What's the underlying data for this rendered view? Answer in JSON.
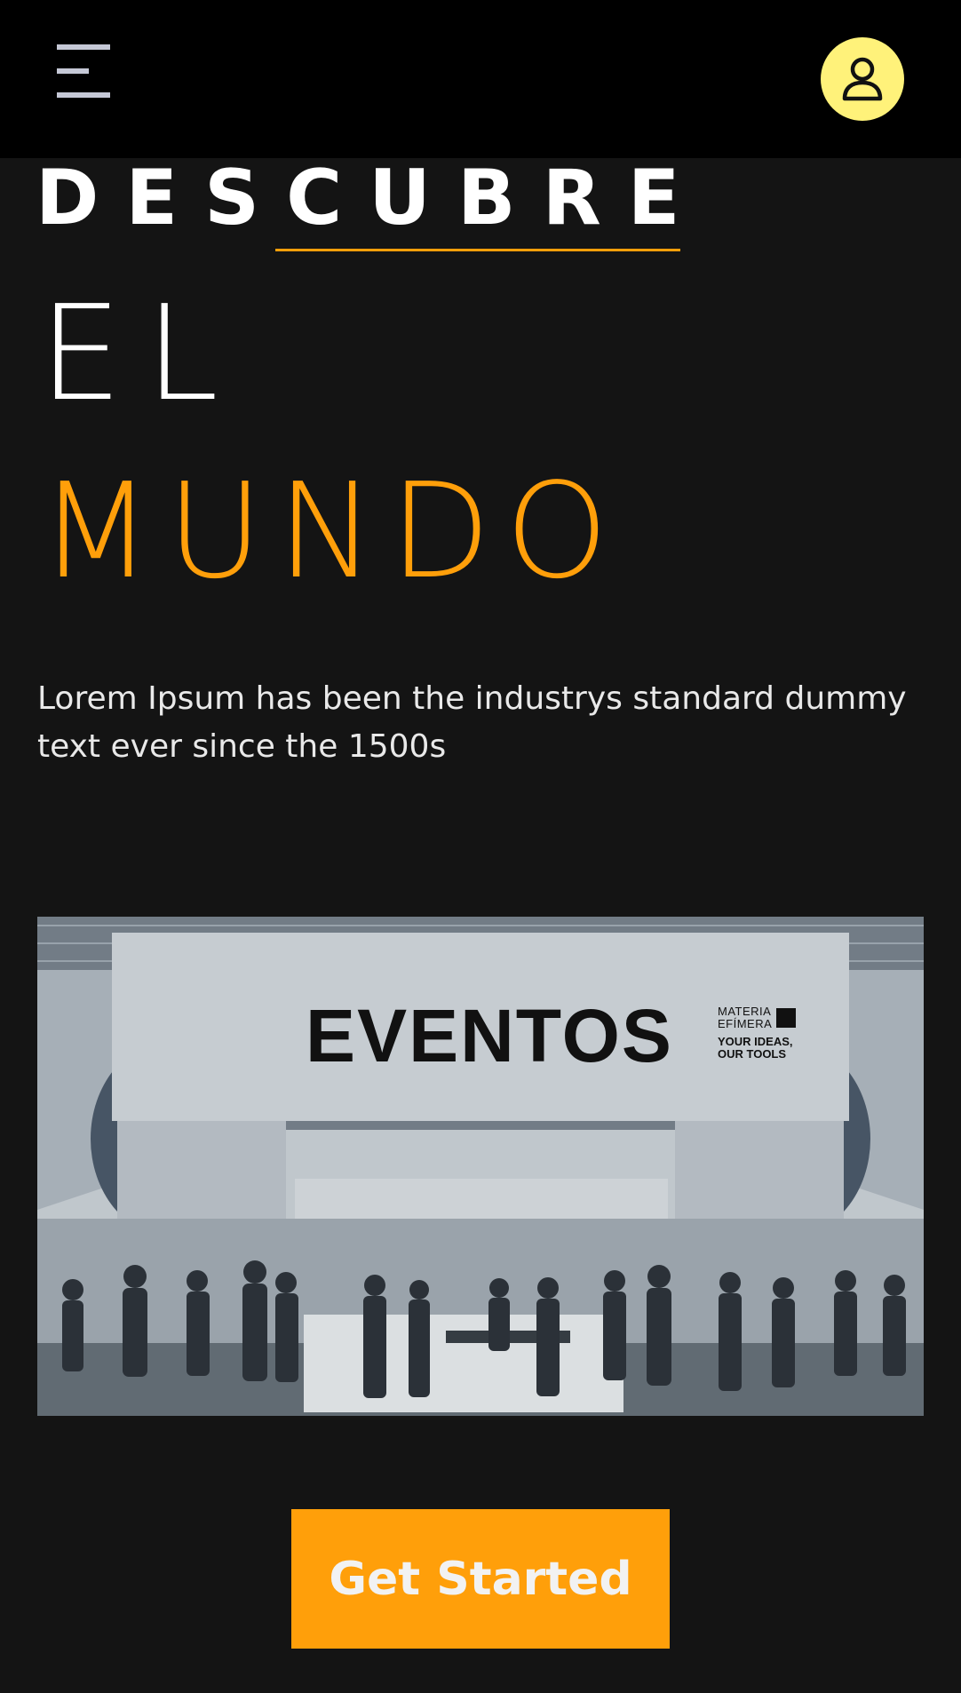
{
  "header": {
    "menu_icon": "hamburger-menu-icon",
    "profile_icon": "user-icon",
    "profile_bg": "#fff27a"
  },
  "hero": {
    "line1": "DESCUBRE",
    "line2": "EL",
    "line3": "MUNDO",
    "accent": "#ff9f0a",
    "description": "Lorem Ipsum has been the industrys standard dummy text ever since the 1500s"
  },
  "banner": {
    "sign_title": "EVENTOS",
    "brand_name": "MATERIA\nEFÍMERA",
    "brand_tagline": "YOUR IDEAS,\nOUR TOOLS"
  },
  "cta": {
    "label": "Get Started"
  }
}
